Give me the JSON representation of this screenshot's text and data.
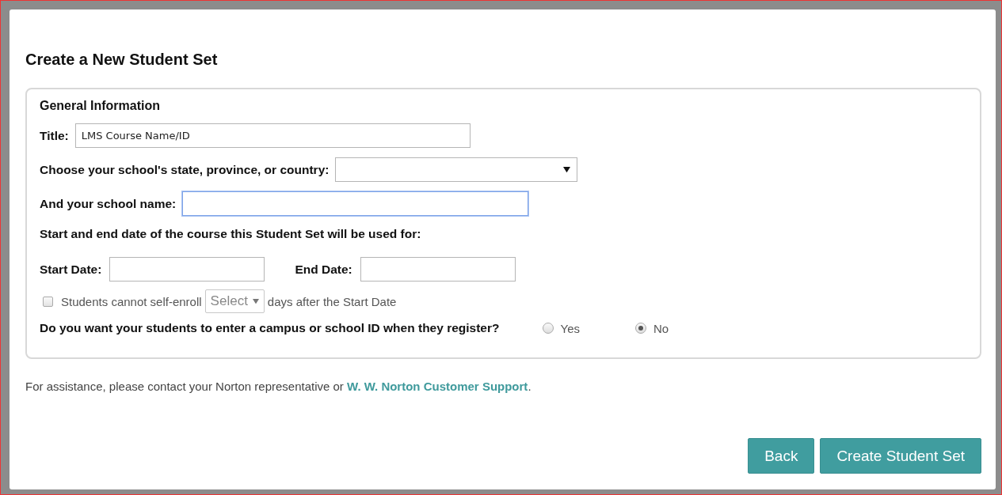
{
  "dialog": {
    "title": "Create a New Student Set"
  },
  "section": {
    "legend": "General Information",
    "title_field": {
      "label": "Title:",
      "value": "LMS Course Name/ID"
    },
    "location_field": {
      "label": "Choose your school's state, province, or country:"
    },
    "school_field": {
      "label": "And your school name:",
      "focused": true
    },
    "dates_prompt": "Start and end date of the course this Student Set will be used for:",
    "start_date": {
      "label": "Start Date:"
    },
    "end_date": {
      "label": "End Date:"
    },
    "self_enroll": {
      "checked": false,
      "label": "Students cannot self-enroll",
      "select": "Select",
      "suffix": "days after the Start Date"
    },
    "student_id": {
      "question": "Do you want your students to enter a campus or school ID when they register?",
      "options": [
        {
          "label": "Yes",
          "selected": false
        },
        {
          "label": "No",
          "selected": true
        }
      ]
    }
  },
  "footer": {
    "text": "For assistance, please contact your Norton representative or ",
    "link": "W. W. Norton Customer Support",
    "end": "."
  },
  "buttons": [
    {
      "label": "Back"
    },
    {
      "label": "Create Student Set"
    }
  ]
}
